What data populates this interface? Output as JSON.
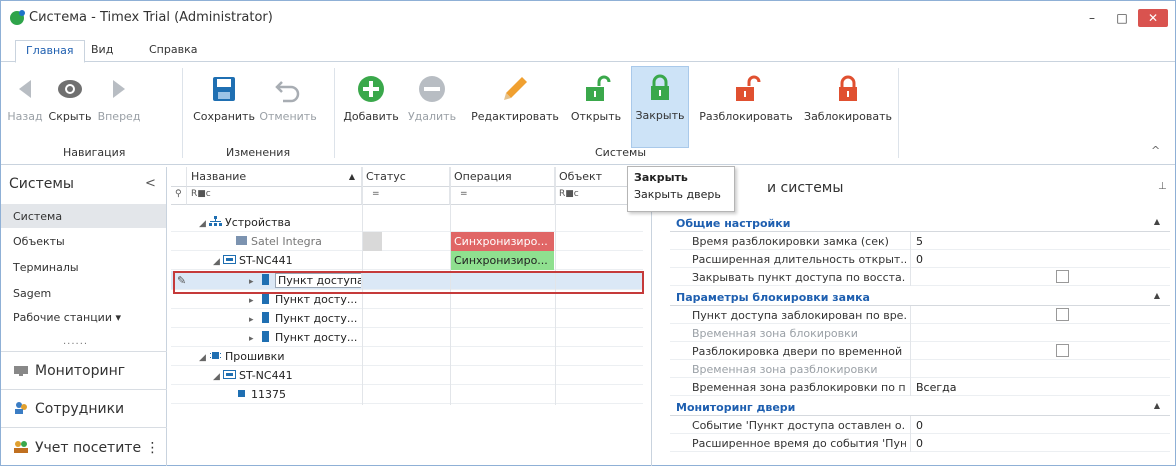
{
  "window": {
    "title": "Система - Timex Trial (Administrator)",
    "min": "–",
    "max": "□",
    "close": "✕"
  },
  "tabs": [
    "Главная",
    "Вид",
    "Справка"
  ],
  "ribbon": {
    "nav": {
      "back": "Назад",
      "hide": "Скрыть",
      "forward": "Вперед",
      "group": "Навигация"
    },
    "changes": {
      "save": "Сохранить",
      "undo": "Отменить",
      "group": "Изменения"
    },
    "systems": {
      "add": "Добавить",
      "delete": "Удалить",
      "edit": "Редактировать",
      "open": "Открыть",
      "close": "Закрыть",
      "unblock": "Разблокировать",
      "block": "Заблокировать",
      "group": "Системы"
    },
    "collapse": "^"
  },
  "tooltip": {
    "title": "Закрыть",
    "text": "Закрыть дверь"
  },
  "nav": {
    "header": "Системы",
    "chevron": "<",
    "items": [
      "Система",
      "Объекты",
      "Терминалы",
      "Sagem",
      "Рабочие станции"
    ],
    "more": "......",
    "sections": [
      "Мониторинг",
      "Сотрудники",
      "Учет посетите"
    ]
  },
  "grid": {
    "columns": [
      "Название",
      "Статус",
      "Операция",
      "Объект"
    ],
    "sort_arrow": "▲",
    "filter_text": "R■c",
    "filter_eq": "=",
    "rows": [
      {
        "name": "Устройства",
        "status": "",
        "op": "",
        "obj": ""
      },
      {
        "name": "Satel Integra",
        "status": "",
        "op": "Синхронизиро...",
        "obj": ""
      },
      {
        "name": "ST-NC441",
        "status": "",
        "op": "Синхронизиро...",
        "obj": ""
      },
      {
        "name": "Пункт доступа",
        "status": "",
        "op": "",
        "obj": ""
      },
      {
        "name": "Пункт досту...",
        "status": "",
        "op": "",
        "obj": ""
      },
      {
        "name": "Пункт досту...",
        "status": "",
        "op": "",
        "obj": ""
      },
      {
        "name": "Пункт досту...",
        "status": "",
        "op": "",
        "obj": ""
      },
      {
        "name": "Прошивки",
        "status": "",
        "op": "",
        "obj": ""
      },
      {
        "name": "ST-NC441",
        "status": "",
        "op": "",
        "obj": ""
      },
      {
        "name": "11375",
        "status": "",
        "op": "",
        "obj": ""
      }
    ]
  },
  "props": {
    "title": "и системы",
    "pin": "⊥",
    "categories": [
      {
        "name": "Общие настройки",
        "rows": [
          {
            "name": "Время разблокировки замка (сек)",
            "value": "5",
            "type": "text"
          },
          {
            "name": "Расширенная длительность открыт...",
            "value": "0",
            "type": "text"
          },
          {
            "name": "Закрывать пункт доступа по восста...",
            "value": "",
            "type": "check"
          }
        ]
      },
      {
        "name": "Параметры блокировки замка",
        "rows": [
          {
            "name": "Пункт доступа заблокирован по вре...",
            "value": "",
            "type": "check"
          },
          {
            "name": "Временная зона блокировки",
            "value": "",
            "type": "disabled"
          },
          {
            "name": "Разблокировка двери по временной ...",
            "value": "",
            "type": "check"
          },
          {
            "name": "Временная зона разблокировки",
            "value": "",
            "type": "disabled"
          },
          {
            "name": "Временная зона разблокировки по п...",
            "value": "Всегда",
            "type": "text"
          }
        ]
      },
      {
        "name": "Мониторинг двери",
        "rows": [
          {
            "name": "Событие 'Пункт доступа оставлен о...",
            "value": "0",
            "type": "text"
          },
          {
            "name": "Расширенное время до события 'Пун...",
            "value": "0",
            "type": "text"
          }
        ]
      }
    ]
  }
}
